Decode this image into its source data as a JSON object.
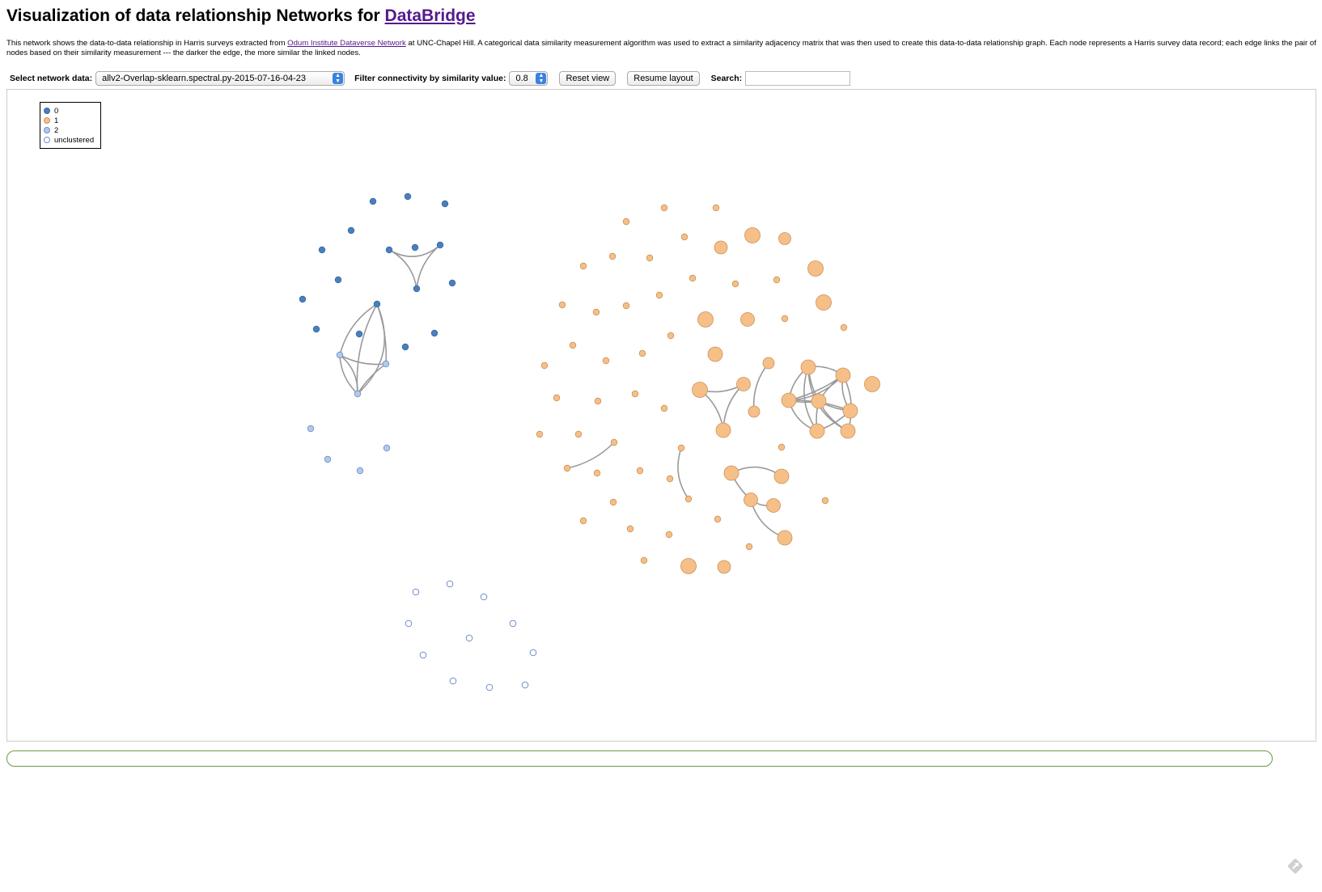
{
  "header": {
    "title_prefix": "Visualization of data relationship Networks for ",
    "title_link": "DataBridge"
  },
  "description": {
    "part1": "This network shows the data-to-data relationship in Harris surveys extracted from ",
    "link": "Odum Institute Dataverse Network",
    "part2": " at UNC-Chapel Hill. A categorical data similarity measurement algorithm was used to extract a similarity adjacency matrix that was then used to create this data-to-data relationship graph. Each node represents a Harris survey data record; each edge links the pair of nodes based on their similarity measurement --- the darker the edge, the more similar the linked nodes."
  },
  "controls": {
    "network_label": "Select network data:",
    "network_value": "allv2-Overlap-sklearn.spectral.py-2015-07-16-04-23",
    "filter_label": "Filter connectivity by similarity value:",
    "filter_value": "0.8",
    "reset_label": "Reset view",
    "resume_label": "Resume layout",
    "search_label": "Search:",
    "search_value": ""
  },
  "legend": {
    "items": [
      {
        "label": "0",
        "color": "#4a7fbd"
      },
      {
        "label": "1",
        "color": "#f7bf88"
      },
      {
        "label": "2",
        "color": "#b3c9ec"
      },
      {
        "label": "unclustered",
        "color": "#ffffff"
      }
    ]
  },
  "colors": {
    "cluster0_fill": "#4a7fbd",
    "cluster0_stroke": "#3a6aa6",
    "cluster1_fill": "#f7bf88",
    "cluster1_stroke": "#c9925a",
    "cluster2_fill": "#b3c9ec",
    "cluster2_stroke": "#6d8fc4",
    "unclustered_stroke": "#6d8fc4",
    "edge": "#9a9a9a",
    "progress_border": "#6a9a4a"
  },
  "icons": {
    "corner": "zoom-icon"
  }
}
